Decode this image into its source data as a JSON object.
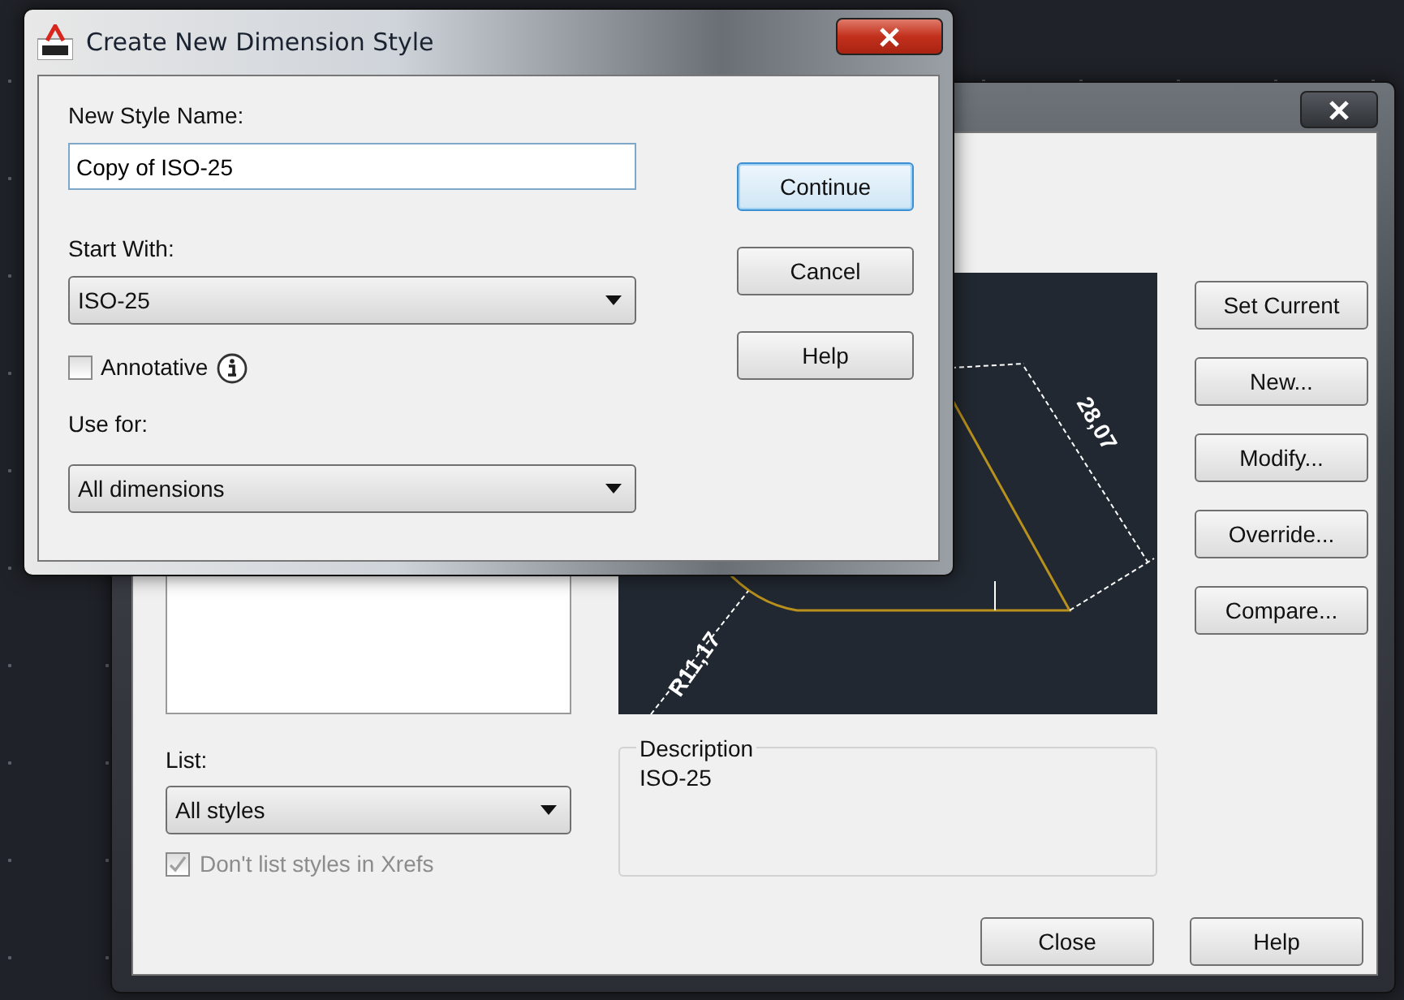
{
  "main_dialog": {
    "buttons": [
      {
        "label": "Set Current"
      },
      {
        "label": "New..."
      },
      {
        "label": "Modify..."
      },
      {
        "label": "Override..."
      },
      {
        "label": "Compare..."
      }
    ],
    "preview": {
      "labels": [
        "28,07",
        "R11,17"
      ]
    },
    "list": {
      "label": "List:",
      "value": "All styles"
    },
    "xrefs": {
      "label": "Don't list styles in Xrefs",
      "checked": true,
      "disabled": true
    },
    "description": {
      "label": "Description",
      "text": "ISO-25"
    },
    "footer_buttons": [
      {
        "label": "Close"
      },
      {
        "label": "Help"
      }
    ]
  },
  "dialog": {
    "title": "Create New Dimension Style",
    "new_style_name": {
      "label": "New Style Name:",
      "value": "Copy of ISO-25"
    },
    "start_with": {
      "label": "Start With:",
      "value": "ISO-25"
    },
    "annotative": {
      "label": "Annotative",
      "checked": false
    },
    "use_for": {
      "label": "Use for:",
      "value": "All dimensions"
    },
    "buttons": [
      {
        "label": "Continue",
        "focused": true
      },
      {
        "label": "Cancel",
        "focused": false
      },
      {
        "label": "Help",
        "focused": false
      }
    ]
  }
}
